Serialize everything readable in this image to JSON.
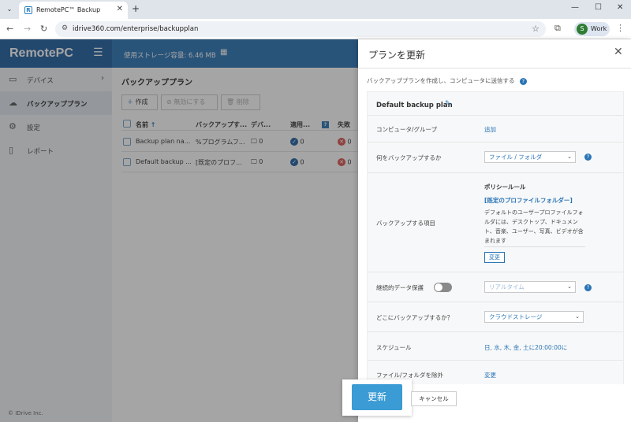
{
  "browser": {
    "tab_title": "RemotePC™ Backup",
    "tab_favicon": "R",
    "url": "idrive360.com/enterprise/backupplan",
    "profile_initial": "S",
    "profile_label": "Work"
  },
  "app": {
    "logo": "RemotePC",
    "storage_usage": "使用ストレージ容量: 6.46 MB",
    "copyright": "© IDrive Inc."
  },
  "sidebar": {
    "items": [
      {
        "label": "デバイス",
        "icon": "devices-icon"
      },
      {
        "label": "バックアッププラン",
        "icon": "cloud-upload-icon"
      },
      {
        "label": "設定",
        "icon": "gear-icon"
      },
      {
        "label": "レポート",
        "icon": "report-icon"
      }
    ]
  },
  "main": {
    "title": "バックアッププラン",
    "toolbar": {
      "create": "作成",
      "disable": "無効にする",
      "delete": "削除"
    },
    "columns": [
      "名前",
      "バックアップす...",
      "デバ...",
      "適用...",
      "失敗"
    ],
    "rows": [
      {
        "name": "Backup plan na...",
        "target": "%プログラムフ...",
        "devices": "0",
        "applied": "0",
        "failed": "0"
      },
      {
        "name": "Default backup ...",
        "target": "[既定のプロフ...",
        "devices": "0",
        "applied": "0",
        "failed": "0"
      }
    ]
  },
  "panel": {
    "title": "プランを更新",
    "intro": "バックアッププランを作成し、コンピュータに送信する",
    "plan_name": "Default backup plan",
    "fields": {
      "computer_group_label": "コンピュータ/グループ",
      "computer_group_value": "追加",
      "what_label": "何をバックアップするか",
      "what_value": "ファイル / フォルダ",
      "items_label": "バックアップする項目",
      "policy_heading": "ポリシールール",
      "policy_link": "[既定のプロファイルフォルダー]",
      "policy_desc": "デフォルトのユーザープロファイルフォルダには、デスクトップ、ドキュメント、音楽、ユーザー、写真、ビデオが含まれます",
      "policy_change": "変更",
      "cdp_label": "継続的データ保護",
      "cdp_value": "リアルタイム",
      "where_label": "どこにバックアップするか？",
      "where_value": "クラウドストレージ",
      "schedule_label": "スケジュール",
      "schedule_value": "日, 水, 木, 金, 土に20:00:00に",
      "exclude_label": "ファイル/フォルダを除外",
      "exclude_value": "変更"
    },
    "update_button": "更新",
    "cancel_button": "キャンセル"
  }
}
